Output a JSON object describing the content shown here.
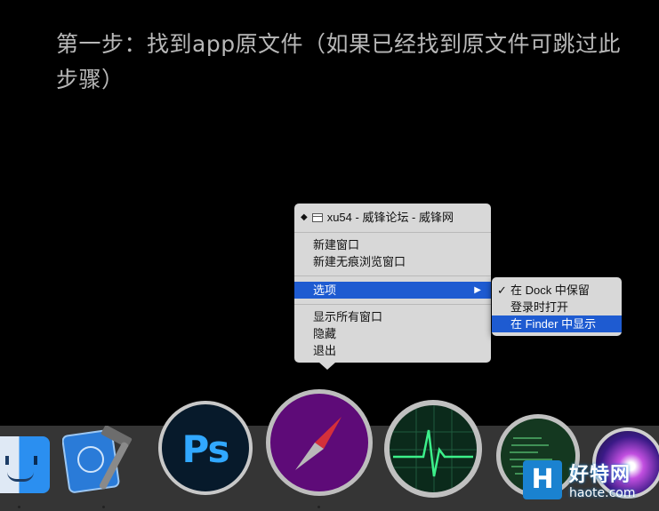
{
  "heading": "第一步：找到app原文件（如果已经找到原文件可跳过此步骤）",
  "menu": {
    "title": "xu54 - 威锋论坛 - 威锋网",
    "items_group1": [
      "新建窗口",
      "新建无痕浏览窗口"
    ],
    "options_label": "选项",
    "items_group3": [
      "显示所有窗口",
      "隐藏",
      "退出"
    ]
  },
  "submenu": {
    "items": [
      "在 Dock 中保留",
      "登录时打开",
      "在 Finder 中显示"
    ],
    "checked_index": 0,
    "selected_index": 2
  },
  "dock": {
    "apps": [
      "finder-icon",
      "xcode-icon",
      "photoshop-icon",
      "safari-icon",
      "activity-monitor-icon",
      "console-icon",
      "siri-icon"
    ],
    "ps_label": "Ps"
  },
  "watermark": {
    "badge": "H",
    "name": "好特网",
    "url": "haote.com"
  },
  "colors": {
    "selection": "#1e5bd1",
    "menu_bg": "#d8d8d8",
    "dock_bg": "#353535",
    "safari_purple": "#5e0b78"
  }
}
